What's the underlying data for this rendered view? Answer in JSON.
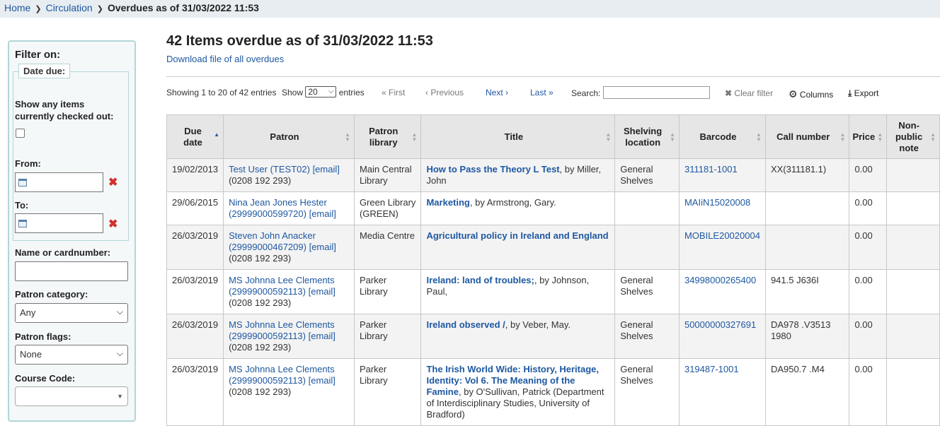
{
  "breadcrumb": {
    "home": "Home",
    "circulation": "Circulation",
    "current": "Overdues as of 31/03/2022 11:53"
  },
  "sidebar": {
    "title": "Filter on:",
    "date_due_legend": "Date due:",
    "show_checked_out_label": "Show any items currently checked out:",
    "from_label": "From:",
    "to_label": "To:",
    "name_label": "Name or cardnumber:",
    "name_value": "",
    "patron_category_label": "Patron category:",
    "patron_category_value": "Any",
    "patron_flags_label": "Patron flags:",
    "patron_flags_value": "None",
    "course_code_label": "Course Code:",
    "course_code_value": ""
  },
  "main": {
    "heading": "42 Items overdue as of 31/03/2022 11:53",
    "download_link": "Download file of all overdues"
  },
  "toolbar": {
    "info": "Showing 1 to 20 of 42 entries",
    "show_label": "Show",
    "show_value": "20",
    "entries_label": "entries",
    "first": "« First",
    "previous": "‹ Previous",
    "next": "Next ›",
    "last": "Last »",
    "search_label": "Search:",
    "search_value": "",
    "clear_filter": "Clear filter",
    "columns": "Columns",
    "export": "Export"
  },
  "table": {
    "columns": [
      "Due date",
      "Patron",
      "Patron library",
      "Title",
      "Shelving location",
      "Barcode",
      "Call number",
      "Price",
      "Non-public note"
    ],
    "rows": [
      {
        "due": "19/02/2013",
        "patron": "Test User (TEST02)",
        "email": "[email]",
        "phone": "(0208 192 293)",
        "library": "Main Central Library",
        "title": "How to Pass the Theory L Test",
        "byline": ", by Miller, John",
        "location": "General Shelves",
        "barcode": "311181-1001",
        "callnumber": "XX(311181.1)",
        "price": "0.00",
        "note": ""
      },
      {
        "due": "29/06/2015",
        "patron": "Nina Jean Jones Hester (29999000599720)",
        "email": "[email]",
        "phone": "",
        "library": "Green Library (GREEN)",
        "title": "Marketing",
        "byline": ", by Armstrong, Gary.",
        "location": "",
        "barcode": "MAIiN15020008",
        "callnumber": "",
        "price": "0.00",
        "note": ""
      },
      {
        "due": "26/03/2019",
        "patron": "Steven John Anacker (29999000467209)",
        "email": "[email]",
        "phone": "(0208 192 293)",
        "library": "Media Centre",
        "title": "Agricultural policy in Ireland and England",
        "byline": "",
        "location": "",
        "barcode": "MOBILE20020004",
        "callnumber": "",
        "price": "0.00",
        "note": ""
      },
      {
        "due": "26/03/2019",
        "patron": "MS Johnna Lee Clements (29999000592113)",
        "email": "[email]",
        "phone": "(0208 192 293)",
        "library": "Parker Library",
        "title": "Ireland: land of troubles;",
        "byline": ", by Johnson, Paul,",
        "location": "General Shelves",
        "barcode": "34998000265400",
        "callnumber": "941.5 J636I",
        "price": "0.00",
        "note": ""
      },
      {
        "due": "26/03/2019",
        "patron": "MS Johnna Lee Clements (29999000592113)",
        "email": "[email]",
        "phone": "(0208 192 293)",
        "library": "Parker Library",
        "title": "Ireland observed /",
        "byline": ", by Veber, May.",
        "location": "General Shelves",
        "barcode": "50000000327691",
        "callnumber": "DA978 .V3513 1980",
        "price": "0.00",
        "note": ""
      },
      {
        "due": "26/03/2019",
        "patron": "MS Johnna Lee Clements (29999000592113)",
        "email": "[email]",
        "phone": "(0208 192 293)",
        "library": "Parker Library",
        "title": "The Irish World Wide: History, Heritage, Identity: Vol 6. The Meaning of the Famine",
        "byline": ", by O'Sullivan, Patrick (Department of Interdisciplinary Studies, University of Bradford)",
        "location": "General Shelves",
        "barcode": "319487-1001",
        "callnumber": "DA950.7 .M4",
        "price": "0.00",
        "note": ""
      }
    ]
  }
}
